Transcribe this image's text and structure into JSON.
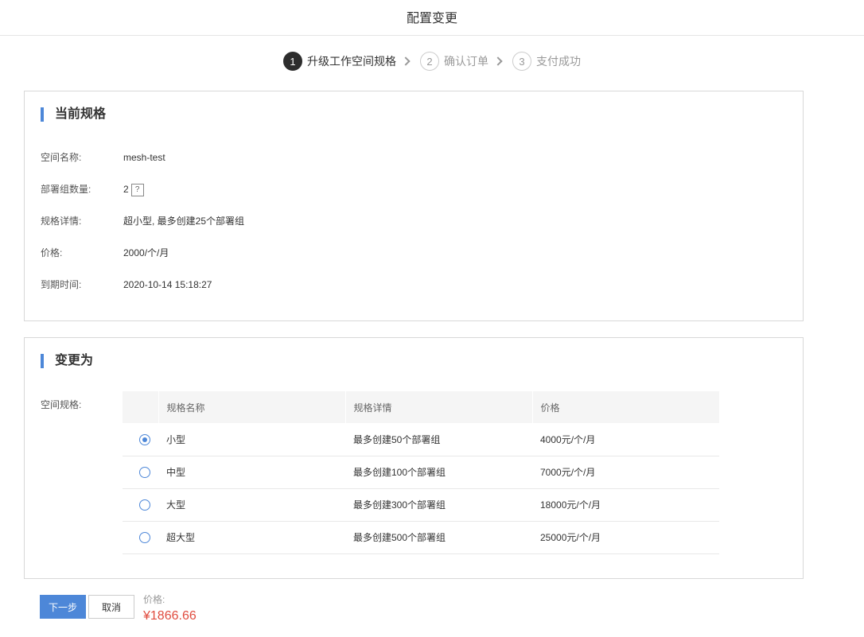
{
  "header": {
    "title": "配置变更"
  },
  "steps": [
    {
      "num": "1",
      "label": "升级工作空间规格"
    },
    {
      "num": "2",
      "label": "确认订单"
    },
    {
      "num": "3",
      "label": "支付成功"
    }
  ],
  "current": {
    "title": "当前规格",
    "fields": {
      "name": {
        "label": "空间名称:",
        "value": "mesh-test"
      },
      "groups": {
        "label": "部署组数量:",
        "value": "2",
        "help": "?"
      },
      "detail": {
        "label": "规格详情:",
        "value": "超小型, 最多创建25个部署组"
      },
      "price": {
        "label": "价格:",
        "value": "2000/个/月"
      },
      "expire": {
        "label": "到期时间:",
        "value": "2020-10-14 15:18:27"
      }
    }
  },
  "change": {
    "title": "变更为",
    "spec_label": "空间规格:",
    "columns": [
      "规格名称",
      "规格详情",
      "价格"
    ],
    "rows": [
      {
        "name": "小型",
        "detail": "最多创建50个部署组",
        "price": "4000元/个/月",
        "selected": true
      },
      {
        "name": "中型",
        "detail": "最多创建100个部署组",
        "price": "7000元/个/月",
        "selected": false
      },
      {
        "name": "大型",
        "detail": "最多创建300个部署组",
        "price": "18000元/个/月",
        "selected": false
      },
      {
        "name": "超大型",
        "detail": "最多创建500个部署组",
        "price": "25000元/个/月",
        "selected": false
      }
    ]
  },
  "footer": {
    "next_label": "下一步",
    "cancel_label": "取消",
    "price_label": "价格:",
    "price_value": "¥1866.66"
  },
  "colors": {
    "accent": "#4d87d8",
    "price": "#e04c3f"
  }
}
